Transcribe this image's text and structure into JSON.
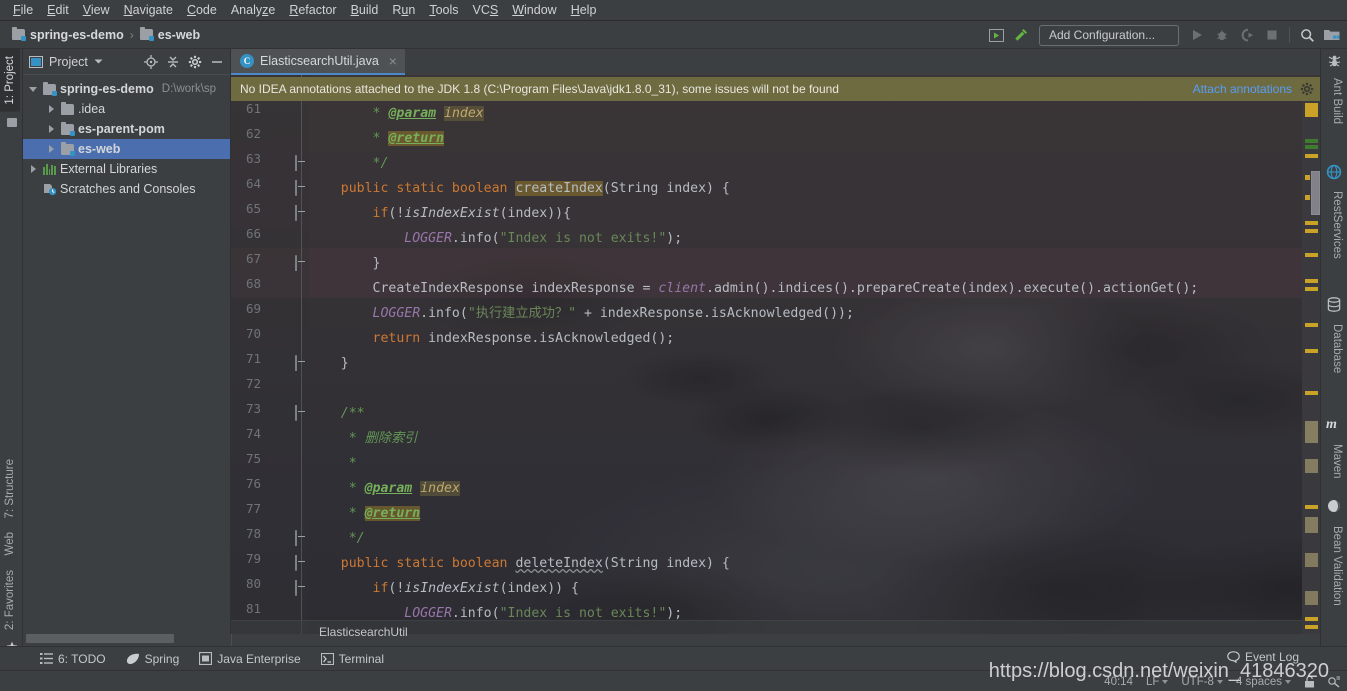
{
  "window": {
    "title": "ElasticsearchUtil.java - spring-es-demo"
  },
  "menubar": {
    "items": [
      {
        "label": "File",
        "mnemonic": "F"
      },
      {
        "label": "Edit",
        "mnemonic": "E"
      },
      {
        "label": "View",
        "mnemonic": "V"
      },
      {
        "label": "Navigate",
        "mnemonic": "N"
      },
      {
        "label": "Code",
        "mnemonic": "C"
      },
      {
        "label": "Analyze",
        "mnemonic": "z"
      },
      {
        "label": "Refactor",
        "mnemonic": "R"
      },
      {
        "label": "Build",
        "mnemonic": "B"
      },
      {
        "label": "Run",
        "mnemonic": "u"
      },
      {
        "label": "Tools",
        "mnemonic": "T"
      },
      {
        "label": "VCS",
        "mnemonic": "S"
      },
      {
        "label": "Window",
        "mnemonic": "W"
      },
      {
        "label": "Help",
        "mnemonic": "H"
      }
    ]
  },
  "navbar": {
    "breadcrumbs": [
      {
        "label": "spring-es-demo"
      },
      {
        "label": "es-web"
      }
    ],
    "separator": "›",
    "run_configuration": "Add Configuration...",
    "icons": [
      "select-in-project-icon",
      "build-hammer-icon",
      "run-icon",
      "debug-icon",
      "run-with-coverage-icon",
      "stop-icon",
      "search-everywhere-icon",
      "project-structure-icon"
    ]
  },
  "left_strip": {
    "top_tabs": [
      {
        "label": "1: Project",
        "active": true
      }
    ],
    "bottom_tabs": [
      {
        "label": "7: Structure"
      },
      {
        "label": "Web"
      },
      {
        "label": "2: Favorites"
      }
    ]
  },
  "project_panel": {
    "title": "Project",
    "header_icons": [
      "target-icon",
      "collapse-all-icon",
      "gear-icon",
      "hide-icon"
    ],
    "tree": [
      {
        "label": "spring-es-demo",
        "path": "D:\\work\\sp",
        "depth": 0,
        "expanded": true,
        "bold": true,
        "icon": "module-folder-icon",
        "selected": false
      },
      {
        "label": ".idea",
        "path": "",
        "depth": 1,
        "expanded": false,
        "bold": false,
        "icon": "folder-icon",
        "selected": false
      },
      {
        "label": "es-parent-pom",
        "path": "",
        "depth": 1,
        "expanded": false,
        "bold": true,
        "icon": "module-folder-icon",
        "selected": false
      },
      {
        "label": "es-web",
        "path": "",
        "depth": 1,
        "expanded": false,
        "bold": true,
        "icon": "module-folder-icon",
        "selected": true
      },
      {
        "label": "External Libraries",
        "path": "",
        "depth": 0,
        "expanded": false,
        "bold": false,
        "icon": "libraries-icon",
        "selected": false
      },
      {
        "label": "Scratches and Consoles",
        "path": "",
        "depth": 0,
        "expanded": null,
        "bold": false,
        "icon": "scratches-icon",
        "selected": false
      }
    ]
  },
  "editor": {
    "tabs": [
      {
        "label": "ElasticsearchUtil.java",
        "icon": "java-class-icon",
        "active": true,
        "close": "×"
      }
    ],
    "notification": {
      "text": "No IDEA annotations attached to the JDK 1.8 (C:\\Program Files\\Java\\jdk1.8.0_31), some issues will not be found",
      "link": "Attach annotations",
      "gear": "gear-icon"
    },
    "breadcrumb": "ElasticsearchUtil",
    "first_line_number": 61,
    "lines": [
      {
        "n": 61,
        "html": "        <span class=\"cmt\">*</span> <span class=\"tag\">@param</span> <span class=\"tagv\">index</span>"
      },
      {
        "n": 62,
        "html": "        <span class=\"cmt\">*</span> <span class=\"tag hl\">@return</span>"
      },
      {
        "n": 63,
        "html": "        <span class=\"cmt\">*/</span>"
      },
      {
        "n": 64,
        "html": "    <span class=\"kw\">public static boolean</span> <span class=\"ident hl\">createIndex</span><span class=\"ident\">(String index) {</span>"
      },
      {
        "n": 65,
        "html": "        <span class=\"kw\">if</span><span class=\"ident\">(!</span><span class=\"it ident\">isIndexExist</span><span class=\"ident\">(index)){</span>"
      },
      {
        "n": 66,
        "html": "            <span class=\"fld\">LOGGER</span><span class=\"ident\">.info(</span><span class=\"str\">\"Index is not exits!\"</span><span class=\"ident\">);</span>"
      },
      {
        "n": 67,
        "html": "        <span class=\"ident\">}</span>"
      },
      {
        "n": 68,
        "html": "        <span class=\"ident\">CreateIndexResponse indexResponse = </span><span class=\"fld\">client</span><span class=\"ident\">.admin().indices().prepareCreate(index).execute().actionGet();</span>"
      },
      {
        "n": 69,
        "html": "        <span class=\"fld\">LOGGER</span><span class=\"ident\">.info(</span><span class=\"str\">\"执行建立成功？\"</span><span class=\"ident\"> + indexResponse.isAcknowledged());</span>"
      },
      {
        "n": 70,
        "html": "        <span class=\"kw\">return</span><span class=\"ident\"> indexResponse.isAcknowledged();</span>"
      },
      {
        "n": 71,
        "html": "    <span class=\"ident\">}</span>"
      },
      {
        "n": 72,
        "html": ""
      },
      {
        "n": 73,
        "html": "    <span class=\"cmt\">/**</span>"
      },
      {
        "n": 74,
        "html": "     <span class=\"cmt\">* 删除索引</span>"
      },
      {
        "n": 75,
        "html": "     <span class=\"cmt\">*</span>"
      },
      {
        "n": 76,
        "html": "     <span class=\"cmt\">*</span> <span class=\"tag\">@param</span> <span class=\"tagv\">index</span>"
      },
      {
        "n": 77,
        "html": "     <span class=\"cmt\">*</span> <span class=\"tag hl\">@return</span>"
      },
      {
        "n": 78,
        "html": "     <span class=\"cmt\">*/</span>"
      },
      {
        "n": 79,
        "html": "    <span class=\"kw\">public static boolean</span> <span class=\"ident err-underline\">deleteIndex</span><span class=\"ident\">(String index) {</span>"
      },
      {
        "n": 80,
        "html": "        <span class=\"kw\">if</span><span class=\"ident\">(!</span><span class=\"it ident\">isIndexExist</span><span class=\"ident\">(index)) {</span>"
      },
      {
        "n": 81,
        "html": "            <span class=\"fld\">LOGGER</span><span class=\"ident\">.info(</span><span class=\"str\">\"Index is not exits!\"</span><span class=\"ident\">);</span>"
      }
    ],
    "fold_markers": [
      {
        "line": 63,
        "type": "up"
      },
      {
        "line": 64,
        "type": "down"
      },
      {
        "line": 65,
        "type": "down"
      },
      {
        "line": 67,
        "type": "up"
      },
      {
        "line": 71,
        "type": "up"
      },
      {
        "line": 73,
        "type": "down"
      },
      {
        "line": 78,
        "type": "up"
      },
      {
        "line": 79,
        "type": "down"
      },
      {
        "line": 80,
        "type": "down"
      }
    ]
  },
  "right_strip": {
    "tabs": [
      {
        "label": "Ant Build",
        "icon": "ant-icon"
      },
      {
        "label": "RestServices",
        "icon": "rest-icon"
      },
      {
        "label": "Database",
        "icon": "database-icon"
      },
      {
        "label": "Maven",
        "icon": "maven-icon"
      },
      {
        "label": "Bean Validation",
        "icon": "bean-icon"
      }
    ]
  },
  "bottom_bar": {
    "buttons": [
      {
        "label": "6: TODO",
        "mnemonic": "6",
        "icon": "todo-list-icon"
      },
      {
        "label": "Spring",
        "mnemonic": "",
        "icon": "spring-leaf-icon"
      },
      {
        "label": "Java Enterprise",
        "mnemonic": "",
        "icon": "java-enterprise-icon"
      },
      {
        "label": "Terminal",
        "mnemonic": "",
        "icon": "terminal-icon"
      }
    ]
  },
  "statusbar": {
    "event_log": "Event Log",
    "caret_position": "40:14",
    "line_separator": "LF",
    "encoding": "UTF-8",
    "indent": "4 spaces",
    "lock_icon": "unlocked-icon",
    "inspection_icon": "inspections-icon"
  },
  "watermark": {
    "text": "https://blog.csdn.net/weixin_41846320"
  },
  "colors": {
    "accent_blue": "#4b6eaf",
    "tab_underline": "#4a88c7",
    "notification_bg": "#6e6b41",
    "link": "#589df6",
    "keyword": "#cc7832",
    "string": "#6a8759",
    "comment": "#629755",
    "field": "#9876aa",
    "javadoc_tag": "#76b05a",
    "highlight": "#94782866",
    "panel_bg": "#3c3f41",
    "editor_bg": "#2b2b2b"
  }
}
